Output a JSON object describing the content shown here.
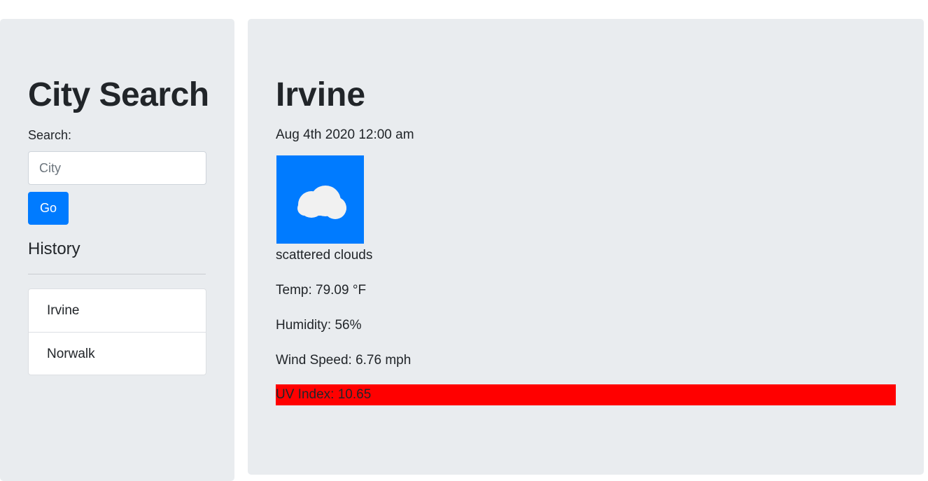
{
  "sidebar": {
    "title": "City Search",
    "search_label": "Search:",
    "search_placeholder": "City",
    "search_value": "",
    "go_label": "Go",
    "history_heading": "History",
    "history_items": [
      {
        "label": "Irvine"
      },
      {
        "label": "Norwalk"
      }
    ]
  },
  "weather": {
    "city": "Irvine",
    "date": "Aug 4th 2020 12:00 am",
    "icon": "cloud-icon",
    "description": "scattered clouds",
    "temp": "Temp: 79.09 °F",
    "humidity": "Humidity: 56%",
    "wind": "Wind Speed: 6.76 mph",
    "uv": "UV Index: 10.65"
  },
  "colors": {
    "primary": "#007bff",
    "panel_background": "#e9ecef",
    "uv_high": "#ff0000"
  }
}
